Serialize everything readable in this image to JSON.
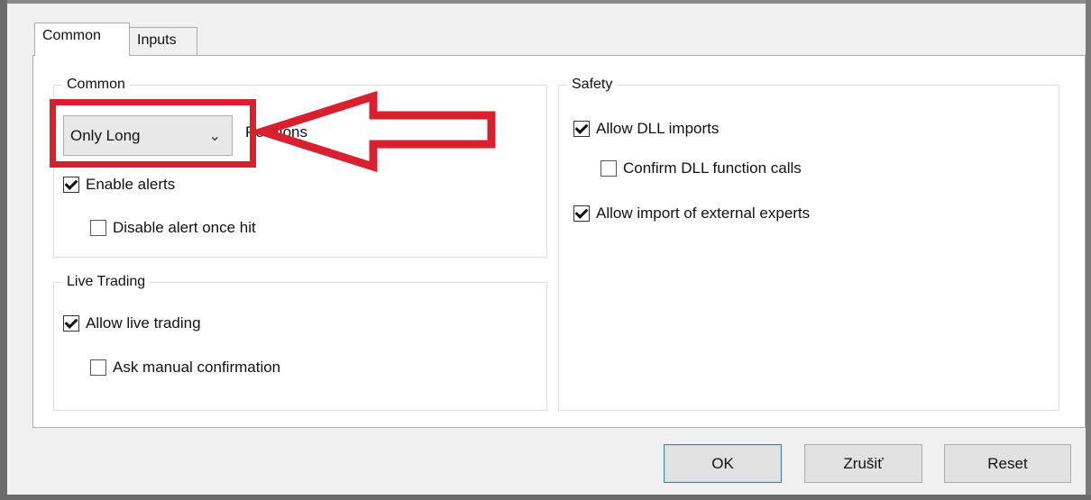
{
  "tabs": [
    {
      "label": "Common",
      "active": true
    },
    {
      "label": "Inputs",
      "active": false
    }
  ],
  "common_group": {
    "title": "Common",
    "positions_combo": {
      "selected": "Only Long",
      "trailing_label": "Positions"
    },
    "enable_alerts": {
      "label": "Enable alerts",
      "checked": true
    },
    "disable_alert_once_hit": {
      "label": "Disable alert once hit",
      "checked": false
    }
  },
  "live_trading_group": {
    "title": "Live Trading",
    "allow_live_trading": {
      "label": "Allow live trading",
      "checked": true
    },
    "ask_manual_confirmation": {
      "label": "Ask manual confirmation",
      "checked": false
    }
  },
  "safety_group": {
    "title": "Safety",
    "allow_dll_imports": {
      "label": "Allow DLL imports",
      "checked": true
    },
    "confirm_dll_function_calls": {
      "label": "Confirm DLL function calls",
      "checked": false
    },
    "allow_import_external_experts": {
      "label": "Allow import of external experts",
      "checked": true
    }
  },
  "buttons": {
    "ok": "OK",
    "cancel": "Zrušiť",
    "reset": "Reset"
  },
  "colors": {
    "annotation": "#d8202e",
    "window_bg": "#f0f0f0",
    "panel_bg": "#ffffff"
  }
}
